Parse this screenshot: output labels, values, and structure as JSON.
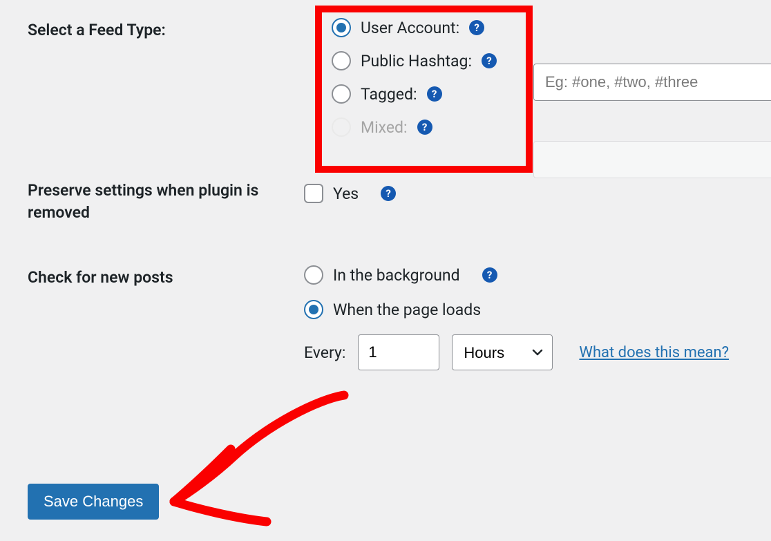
{
  "labels": {
    "feed_type": "Select a Feed Type:",
    "preserve": "Preserve settings when plugin is removed",
    "check_posts": "Check for new posts"
  },
  "feed_type": {
    "options": {
      "user_account": "User Account:",
      "public_hashtag": "Public Hashtag:",
      "tagged": "Tagged:",
      "mixed": "Mixed:"
    },
    "hashtag_placeholder": "Eg: #one, #two, #three",
    "hashtag_value": "",
    "mixed_value": ""
  },
  "preserve": {
    "yes": "Yes"
  },
  "check_posts": {
    "background": "In the background",
    "page_loads": "When the page loads",
    "every": "Every:",
    "every_value": "1",
    "unit_selected": "Hours",
    "what_link": "What does this mean?"
  },
  "help_glyph": "?",
  "save_button": "Save Changes"
}
